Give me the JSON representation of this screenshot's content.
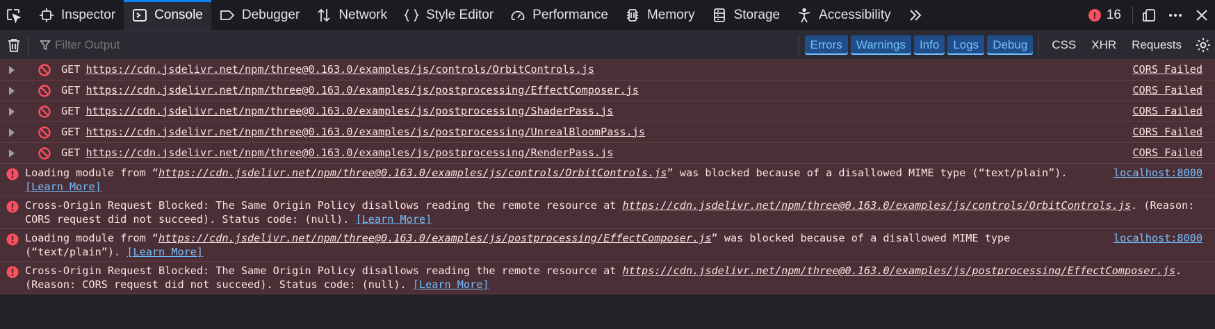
{
  "tabs": {
    "inspector": "Inspector",
    "console": "Console",
    "debugger": "Debugger",
    "network": "Network",
    "style_editor": "Style Editor",
    "performance": "Performance",
    "memory": "Memory",
    "storage": "Storage",
    "accessibility": "Accessibility"
  },
  "error_count": "16",
  "toolbar": {
    "filter_placeholder": "Filter Output",
    "levels": [
      "Errors",
      "Warnings",
      "Info",
      "Logs",
      "Debug"
    ],
    "extra": [
      "CSS",
      "XHR",
      "Requests"
    ]
  },
  "network_messages": [
    {
      "method": "GET",
      "url": "https://cdn.jsdelivr.net/npm/three@0.163.0/examples/js/controls/OrbitControls.js",
      "status": "CORS Failed"
    },
    {
      "method": "GET",
      "url": "https://cdn.jsdelivr.net/npm/three@0.163.0/examples/js/postprocessing/EffectComposer.js",
      "status": "CORS Failed"
    },
    {
      "method": "GET",
      "url": "https://cdn.jsdelivr.net/npm/three@0.163.0/examples/js/postprocessing/ShaderPass.js",
      "status": "CORS Failed"
    },
    {
      "method": "GET",
      "url": "https://cdn.jsdelivr.net/npm/three@0.163.0/examples/js/postprocessing/UnrealBloomPass.js",
      "status": "CORS Failed"
    },
    {
      "method": "GET",
      "url": "https://cdn.jsdelivr.net/npm/three@0.163.0/examples/js/postprocessing/RenderPass.js",
      "status": "CORS Failed"
    }
  ],
  "errors": [
    {
      "pre": "Loading module from “",
      "link": "https://cdn.jsdelivr.net/npm/three@0.163.0/examples/js/controls/OrbitControls.js",
      "post": "” was blocked because of a disallowed MIME type (“text/plain”). ",
      "learn": "[Learn More]",
      "source": "localhost:8000"
    },
    {
      "pre": "Cross-Origin Request Blocked: The Same Origin Policy disallows reading the remote resource at ",
      "link": "https://cdn.jsdelivr.net/npm/three@0.163.0/examples/js/controls/OrbitControls.js",
      "post": ". (Reason: CORS request did not succeed). Status code: (null). ",
      "learn": "[Learn More]",
      "source": ""
    },
    {
      "pre": "Loading module from “",
      "link": "https://cdn.jsdelivr.net/npm/three@0.163.0/examples/js/postprocessing/EffectComposer.js",
      "post": "” was blocked because of a disallowed MIME type (“text/plain”). ",
      "learn": "[Learn More]",
      "source": "localhost:8000"
    },
    {
      "pre": "Cross-Origin Request Blocked: The Same Origin Policy disallows reading the remote resource at ",
      "link": "https://cdn.jsdelivr.net/npm/three@0.163.0/examples/js/postprocessing/EffectComposer.js",
      "post": ". (Reason: CORS request did not succeed). Status code: (null). ",
      "learn": "[Learn More]",
      "source": ""
    }
  ],
  "colors": {
    "accent": "#0a84ff",
    "error_bg": "#4b2f36",
    "error_icon": "#ff4f5e",
    "link": "#75bfff"
  }
}
